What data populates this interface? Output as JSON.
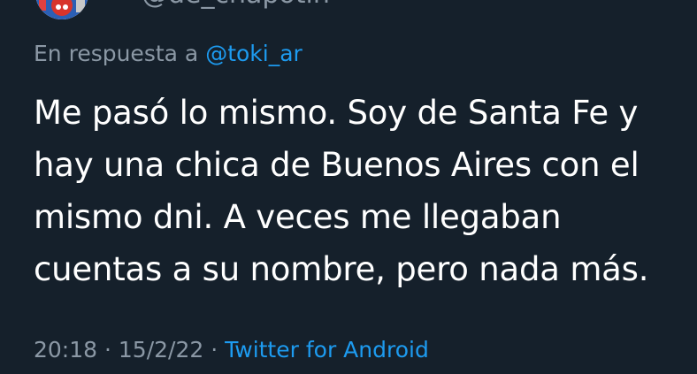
{
  "author": {
    "handle": "@de_chapotin"
  },
  "reply": {
    "prefix": "En respuesta a ",
    "mention": "@toki_ar"
  },
  "tweet": {
    "lines": [
      "Me pasó lo mismo. Soy de Santa Fe y",
      "hay una chica de Buenos Aires con el",
      "mismo dni. A veces me llegaban",
      "cuentas a su nombre, pero nada más."
    ]
  },
  "meta": {
    "time": "20:18",
    "separator1": " · ",
    "date": "15/2/22",
    "separator2": " · ",
    "source": "Twitter for Android"
  },
  "colors": {
    "background": "#15202b",
    "secondary_text": "#8b98a5",
    "accent": "#1d9bf0",
    "primary_text": "#ffffff"
  }
}
